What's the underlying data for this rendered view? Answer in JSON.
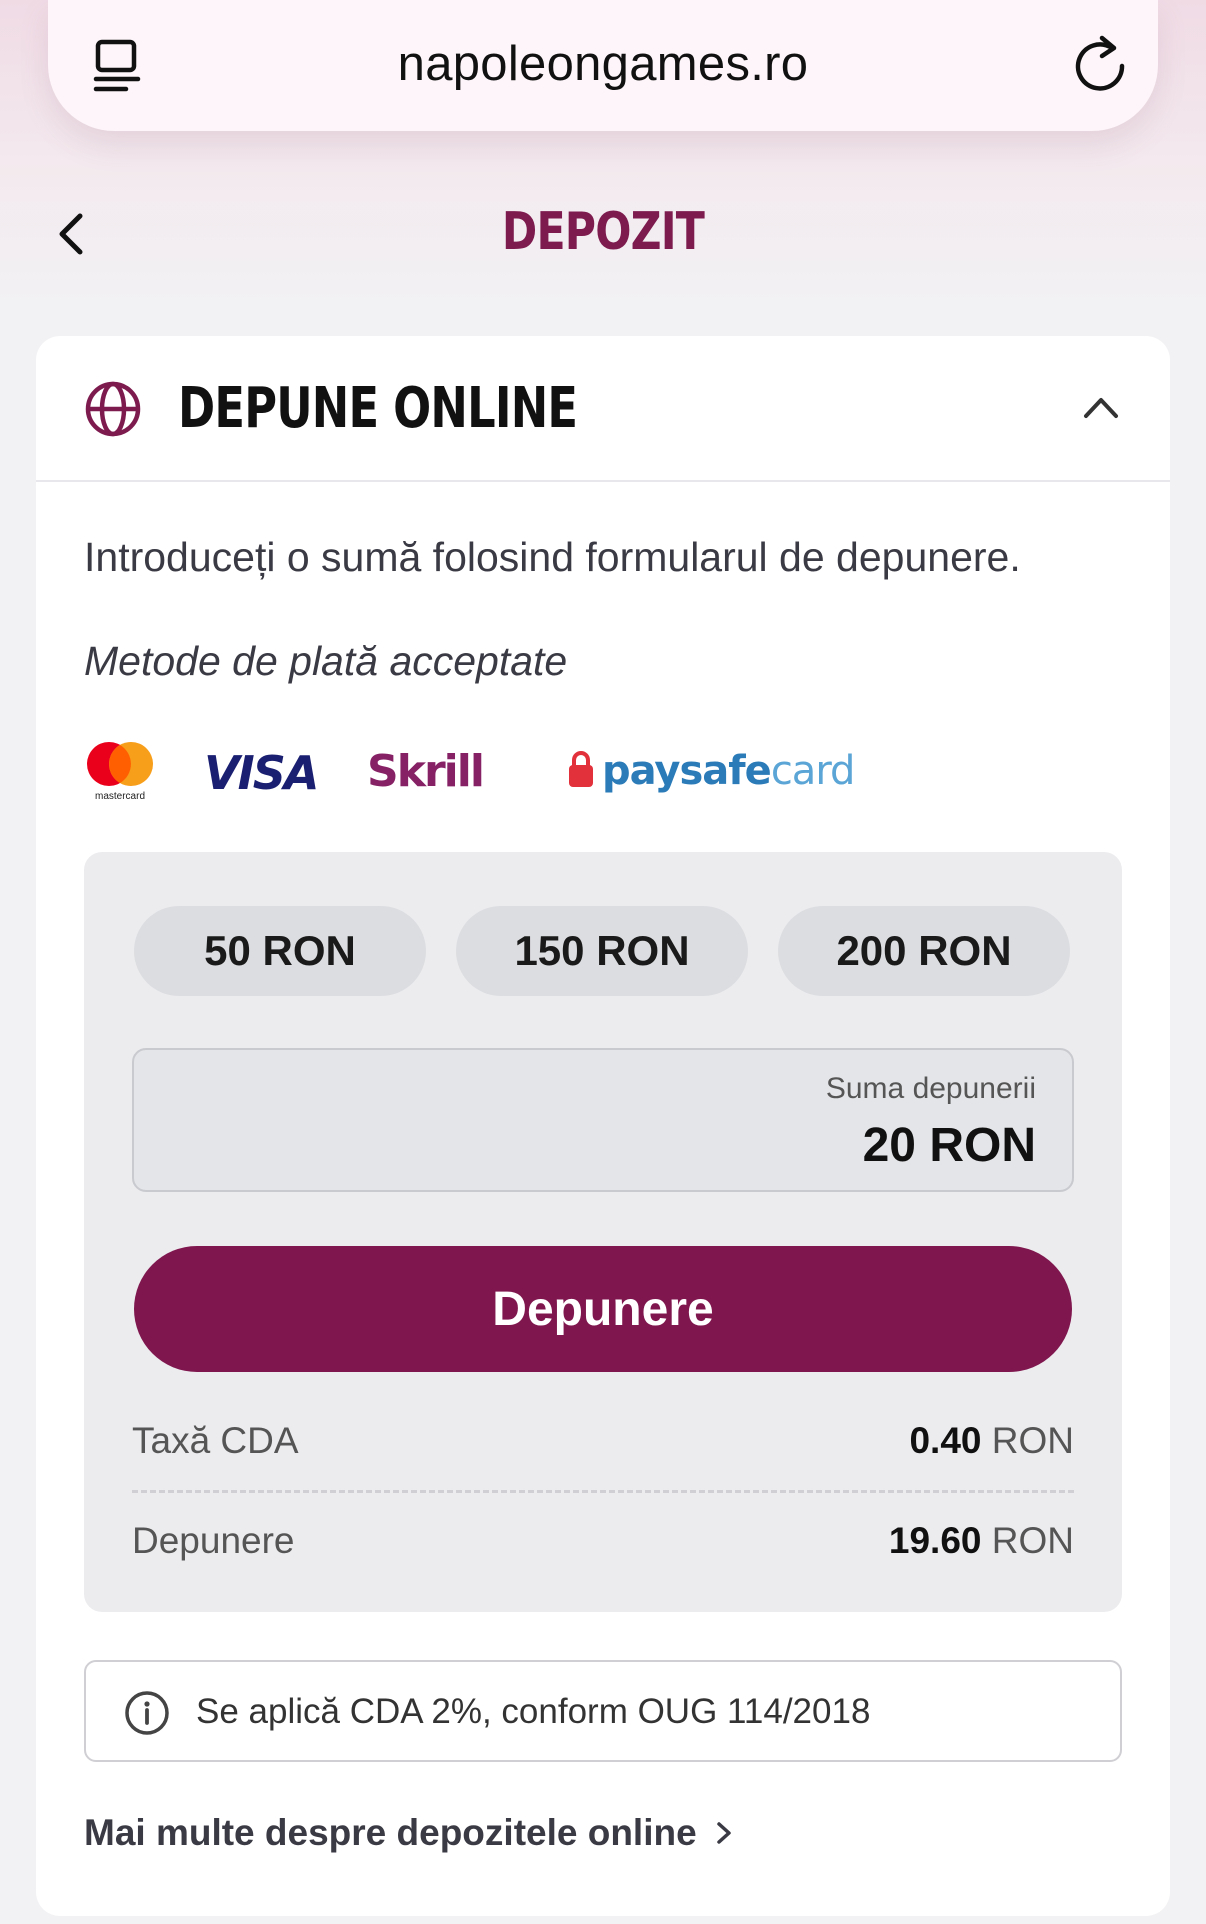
{
  "browser": {
    "url": "napoleongames.ro",
    "reader_icon": "reader-mode-icon",
    "reload_icon": "reload-icon"
  },
  "header": {
    "title": "DEPOZIT",
    "back_icon": "chevron-left-icon"
  },
  "section": {
    "title": "DEPUNE ONLINE",
    "icon": "globe-icon",
    "collapse_icon": "chevron-up-icon",
    "intro": "Introduceți o sumă folosind formularul de depunere.",
    "methods_label": "Metode de plată acceptate",
    "payment_methods": [
      {
        "name": "mastercard",
        "label": "mastercard"
      },
      {
        "name": "visa",
        "label": "VISA"
      },
      {
        "name": "skrill",
        "label": "Skrill"
      },
      {
        "name": "paysafecard",
        "label_bold": "paysafe",
        "label_light": "card"
      }
    ]
  },
  "deposit": {
    "quick_amounts": [
      "50 RON",
      "150 RON",
      "200 RON"
    ],
    "amount_label": "Suma depunerii",
    "amount_value": "20 RON",
    "submit_label": "Depunere",
    "fee_label": "Taxă CDA",
    "fee_value": "0.40",
    "fee_currency": "RON",
    "net_label": "Depunere",
    "net_value": "19.60",
    "net_currency": "RON"
  },
  "note": {
    "icon": "info-icon",
    "text": "Se aplică CDA 2%, conform OUG 114/2018"
  },
  "more_link": {
    "label": "Mai multe despre depozitele online",
    "icon": "chevron-right-icon"
  },
  "colors": {
    "brand": "#7f174e",
    "title": "#7d1a4e",
    "panel_bg": "#ececef",
    "chip_bg": "#dcdde0"
  }
}
